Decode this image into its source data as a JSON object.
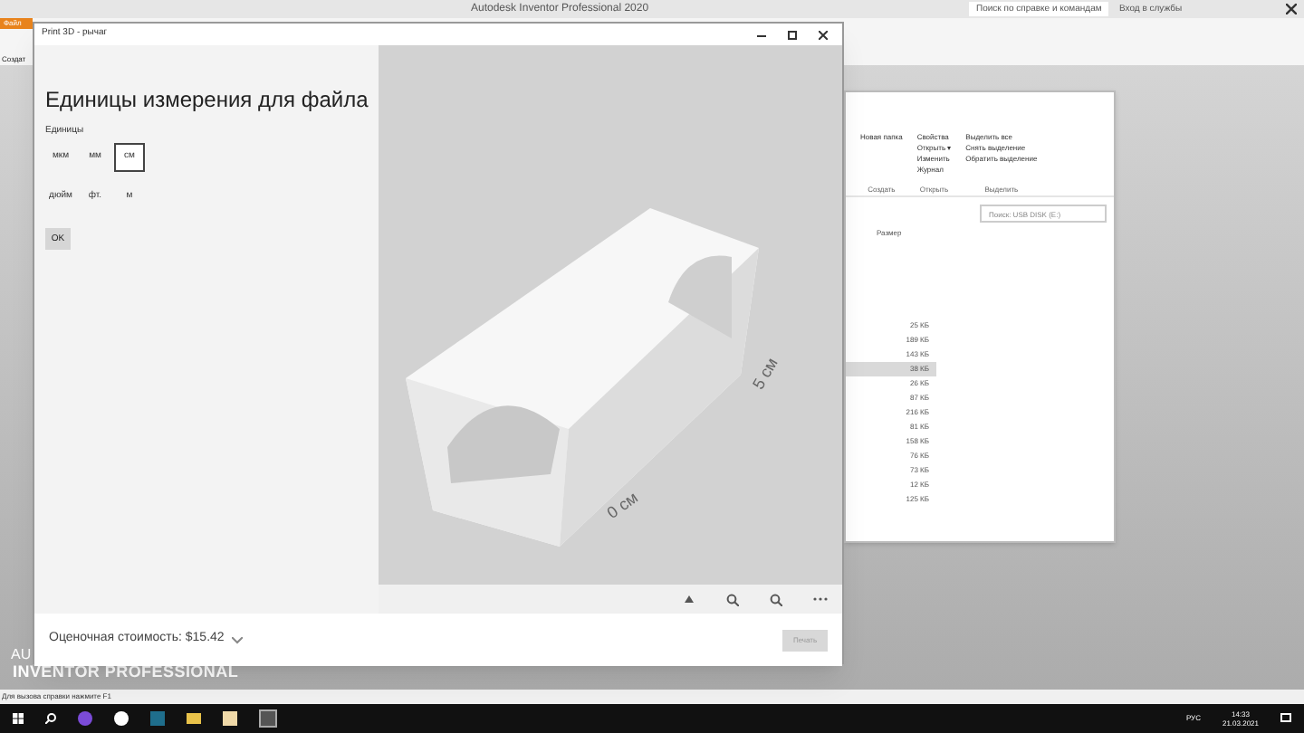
{
  "app": {
    "title": "Autodesk Inventor Professional 2020",
    "file_tab": "Файл",
    "create_label": "Создат",
    "help_search": "Поиск по справке и командам",
    "sign_in": "Вход в службы",
    "brand_top": "AU",
    "brand": "INVENTOR PROFESSIONAL",
    "status": "Для вызова справки нажмите F1"
  },
  "print3d": {
    "title": "Print 3D - рычаг",
    "heading": "Единицы измерения для файла",
    "units_label": "Единицы",
    "units": [
      {
        "label": "мкм",
        "selected": false
      },
      {
        "label": "мм",
        "selected": false
      },
      {
        "label": "см",
        "selected": true
      },
      {
        "label": "дюйм",
        "selected": false
      },
      {
        "label": "фт.",
        "selected": false
      },
      {
        "label": "м",
        "selected": false
      }
    ],
    "ok": "OK",
    "dim_height": "5 см",
    "dim_width": "0 см",
    "cost": "Оценочная стоимость: $15.42",
    "print": "Печать"
  },
  "explorer": {
    "ribbon": [
      {
        "group": "Создать",
        "items": [
          "Новая папка"
        ]
      },
      {
        "group": "Открыть",
        "items": [
          "Свойства",
          "Открыть ▾",
          "Изменить",
          "Журнал"
        ]
      },
      {
        "group": "Выделить",
        "items": [
          "Выделить все",
          "Снять выделение",
          "Обратить выделение"
        ]
      }
    ],
    "search": {
      "placeholder": "Поиск: USB DISK (E:)"
    },
    "column": "Размер",
    "rows": [
      {
        "size": "25 КБ",
        "selected": false
      },
      {
        "size": "189 КБ",
        "selected": false
      },
      {
        "size": "143 КБ",
        "selected": false
      },
      {
        "size": "38 КБ",
        "selected": true
      },
      {
        "size": "26 КБ",
        "selected": false
      },
      {
        "size": "87 КБ",
        "selected": false
      },
      {
        "size": "216 КБ",
        "selected": false
      },
      {
        "size": "81 КБ",
        "selected": false
      },
      {
        "size": "158 КБ",
        "selected": false
      },
      {
        "size": "76 КБ",
        "selected": false
      },
      {
        "size": "73 КБ",
        "selected": false
      },
      {
        "size": "12 КБ",
        "selected": false
      },
      {
        "size": "125 КБ",
        "selected": false
      }
    ]
  },
  "taskbar": {
    "lang": "РУС",
    "time": "14:33",
    "date": "21.03.2021"
  }
}
